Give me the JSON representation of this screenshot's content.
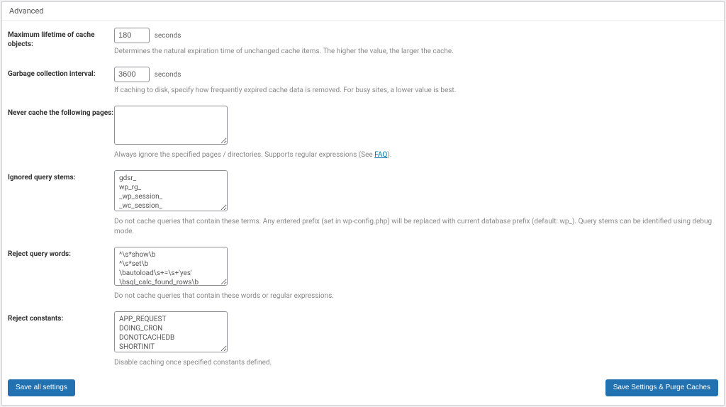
{
  "panel": {
    "title": "Advanced"
  },
  "fields": {
    "lifetime": {
      "label": "Maximum lifetime of cache objects:",
      "value": "180",
      "unit": "seconds",
      "help": "Determines the natural expiration time of unchanged cache items. The higher the value, the larger the cache."
    },
    "gc": {
      "label": "Garbage collection interval:",
      "value": "3600",
      "unit": "seconds",
      "help": "If caching to disk, specify how frequently expired cache data is removed. For busy sites, a lower value is best."
    },
    "never_cache": {
      "label": "Never cache the following pages:",
      "value": "",
      "help_pre": "Always ignore the specified pages / directories. Supports regular expressions (See ",
      "help_link": "FAQ",
      "help_post": ")."
    },
    "query_stems": {
      "label": "Ignored query stems:",
      "value": "gdsr_\nwp_rg_\n_wp_session_\n_wc_session_",
      "help": "Do not cache queries that contain these terms. Any entered prefix (set in wp-config.php) will be replaced with current database prefix (default: wp_). Query stems can be identified using debug mode."
    },
    "reject_words": {
      "label": "Reject query words:",
      "value": "^\\s*show\\b\n^\\s*set\\b\n\\bautoload\\s+=\\s+'yes'\n\\bsql_calc_found_rows\\b\n\\bfound_rows\\(\\)",
      "help": "Do not cache queries that contain these words or regular expressions."
    },
    "reject_constants": {
      "label": "Reject constants:",
      "value": "APP_REQUEST\nDOING_CRON\nDONOTCACHEDB\nSHORTINIT\nXMLRPC_REQUEST",
      "help": "Disable caching once specified constants defined."
    }
  },
  "buttons": {
    "save_all": "Save all settings",
    "save_purge": "Save Settings & Purge Caches"
  }
}
